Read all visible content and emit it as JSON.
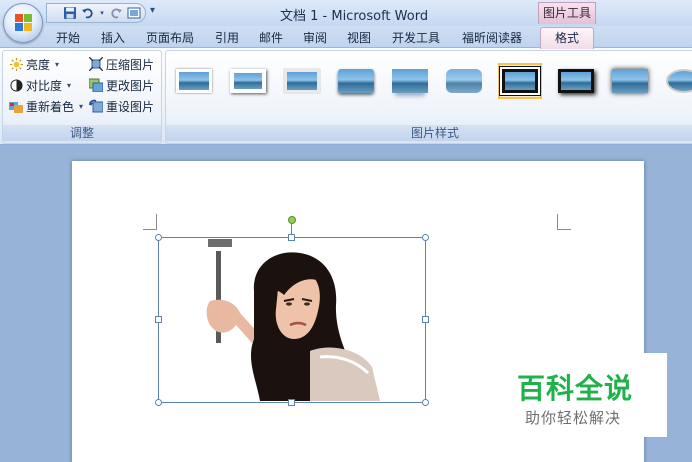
{
  "window": {
    "title": "文档 1 - Microsoft Word",
    "context_tool": "图片工具"
  },
  "qat": {
    "save_icon": "save-icon",
    "undo_icon": "undo-icon",
    "redo_icon": "redo-icon",
    "print_icon": "print-preview-icon"
  },
  "tabs": [
    "开始",
    "插入",
    "页面布局",
    "引用",
    "邮件",
    "审阅",
    "视图",
    "开发工具",
    "福昕阅读器"
  ],
  "active_tab": "格式",
  "ribbon": {
    "adjust_group": {
      "label": "调整",
      "brightness": "亮度",
      "contrast": "对比度",
      "recolor": "重新着色",
      "compress": "压缩图片",
      "change": "更改图片",
      "reset": "重设图片"
    },
    "styles_group": {
      "label": "图片样式",
      "thumb_count": 11
    }
  },
  "watermark": {
    "title": "百科全说",
    "subtitle": "助你轻松解决",
    "color": "#20b24a"
  }
}
